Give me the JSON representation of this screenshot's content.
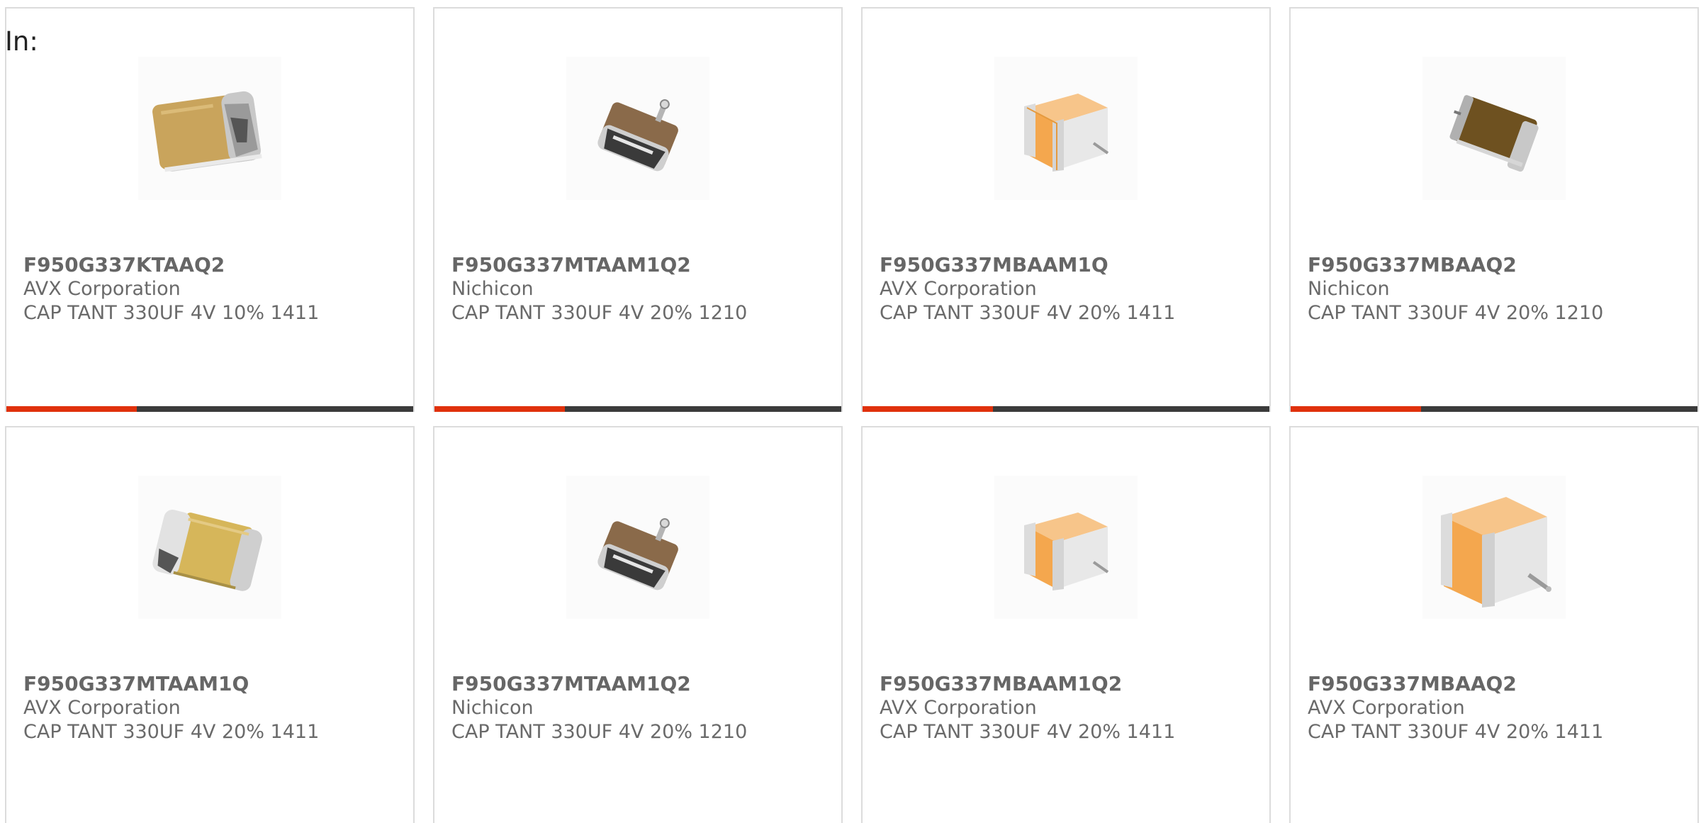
{
  "header": {
    "in_label": "In:"
  },
  "colors": {
    "accent": "#e0310c",
    "bar_track": "#3b3b3b",
    "card_border": "#dcdcdc",
    "text": "#6a6a6a"
  },
  "products": [
    {
      "part": "F950G337KTAAQ2",
      "manufacturer": "AVX Corporation",
      "description": "CAP TANT 330UF 4V 10% 1411",
      "image_icon": "capacitor-tan-silver-icon",
      "progress": 0.32
    },
    {
      "part": "F950G337MTAAM1Q2",
      "manufacturer": "Nichicon",
      "description": "CAP TANT 330UF 4V 20% 1210",
      "image_icon": "capacitor-brown-small-icon",
      "progress": 0.32
    },
    {
      "part": "F950G337MBAAM1Q",
      "manufacturer": "AVX Corporation",
      "description": "CAP TANT 330UF 4V 20% 1411",
      "image_icon": "capacitor-orange-icon",
      "progress": 0.32
    },
    {
      "part": "F950G337MBAAQ2",
      "manufacturer": "Nichicon",
      "description": "CAP TANT 330UF 4V 20% 1210",
      "image_icon": "capacitor-dark-brown-icon",
      "progress": 0.32
    },
    {
      "part": "F950G337MTAAM1Q",
      "manufacturer": "AVX Corporation",
      "description": "CAP TANT 330UF 4V 20% 1411",
      "image_icon": "capacitor-tan-silver-icon"
    },
    {
      "part": "F950G337MTAAM1Q2",
      "manufacturer": "Nichicon",
      "description": "CAP TANT 330UF 4V 20% 1210",
      "image_icon": "capacitor-brown-small-icon"
    },
    {
      "part": "F950G337MBAAM1Q2",
      "manufacturer": "AVX Corporation",
      "description": "CAP TANT 330UF 4V 20% 1411",
      "image_icon": "capacitor-orange-icon"
    },
    {
      "part": "F950G337MBAAQ2",
      "manufacturer": "AVX Corporation",
      "description": "CAP TANT 330UF 4V 20% 1411",
      "image_icon": "capacitor-orange-large-icon"
    }
  ]
}
